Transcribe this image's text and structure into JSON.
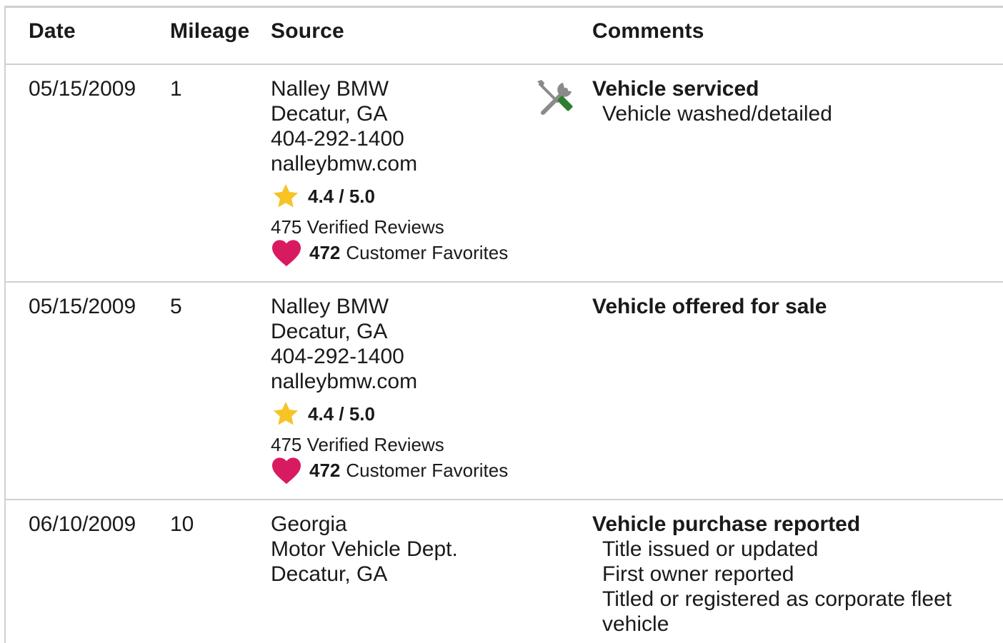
{
  "headers": {
    "date": "Date",
    "mileage": "Mileage",
    "source": "Source",
    "comments": "Comments"
  },
  "rows": [
    {
      "date": "05/15/2009",
      "mileage": "1",
      "source": [
        "Nalley BMW",
        "Decatur, GA",
        "404-292-1400",
        "nalleybmw.com"
      ],
      "rating": "4.4 / 5.0",
      "reviews": "475 Verified Reviews",
      "favorites_count": "472",
      "favorites_label": "Customer Favorites",
      "icon": "service-tools-icon",
      "comment_title": "Vehicle serviced",
      "comment_lines": [
        "Vehicle washed/detailed"
      ]
    },
    {
      "date": "05/15/2009",
      "mileage": "5",
      "source": [
        "Nalley BMW",
        "Decatur, GA",
        "404-292-1400",
        "nalleybmw.com"
      ],
      "rating": "4.4 / 5.0",
      "reviews": "475 Verified Reviews",
      "favorites_count": "472",
      "favorites_label": "Customer Favorites",
      "comment_title": "Vehicle offered for sale",
      "comment_lines": []
    },
    {
      "date": "06/10/2009",
      "mileage": "10",
      "source": [
        "Georgia",
        "Motor Vehicle Dept.",
        "Decatur, GA"
      ],
      "comment_title": "Vehicle purchase reported",
      "comment_lines": [
        "Title issued or updated",
        "First owner reported",
        "Titled or registered as corporate fleet",
        "vehicle"
      ]
    }
  ],
  "colors": {
    "star": "#f7c325",
    "heart": "#d81b60",
    "wrench_grey": "#8a8a8a",
    "screwdriver_green": "#2e7d32",
    "divider": "#d0d0d0"
  }
}
